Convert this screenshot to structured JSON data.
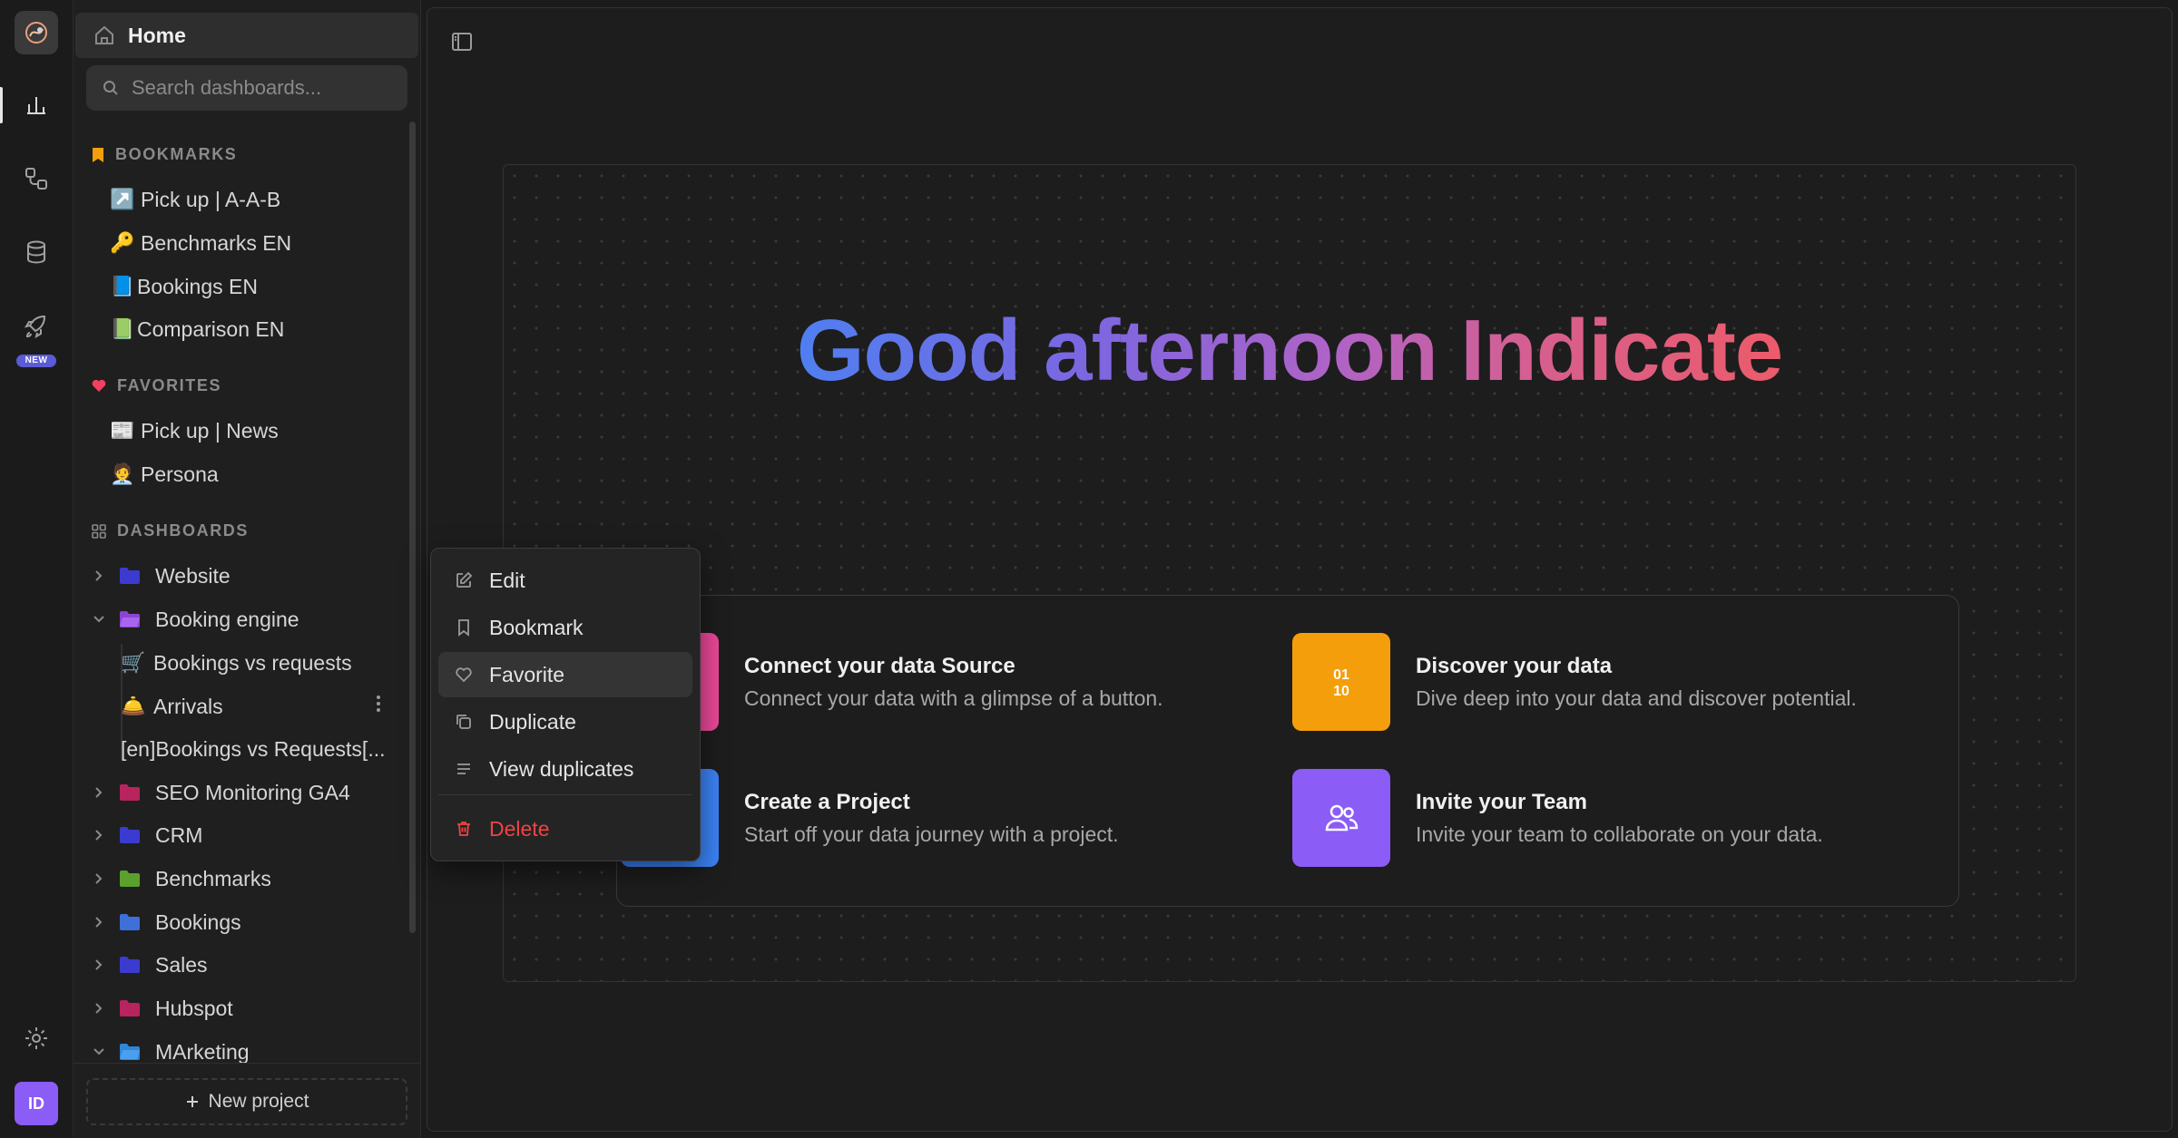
{
  "rail": {
    "new_badge": "NEW",
    "avatar_initials": "ID",
    "icons": [
      "logo-icon",
      "chart-icon",
      "workflow-icon",
      "database-icon",
      "rocket-icon",
      "gear-icon"
    ]
  },
  "sidebar": {
    "home_label": "Home",
    "search_placeholder": "Search dashboards...",
    "bookmarks": {
      "title": "BOOKMARKS",
      "items": [
        {
          "emoji": "↗️",
          "label": "Pick up | A-A-B"
        },
        {
          "emoji": "🔑",
          "label": "Benchmarks EN"
        },
        {
          "emoji": "📘",
          "label": "Bookings EN"
        },
        {
          "emoji": "📗",
          "label": "Comparison EN"
        }
      ]
    },
    "favorites": {
      "title": "FAVORITES",
      "items": [
        {
          "emoji": "📰",
          "label": "Pick up | News"
        },
        {
          "emoji": "🧑‍💼",
          "label": "Persona"
        }
      ]
    },
    "dashboards": {
      "title": "DASHBOARDS",
      "folders": [
        {
          "label": "Website",
          "color": "#3b3bd0",
          "expanded": false
        },
        {
          "label": "Booking engine",
          "color": "#8b45d6",
          "expanded": true
        },
        {
          "label": "SEO Monitoring GA4",
          "color": "#b8245e",
          "expanded": false
        },
        {
          "label": "CRM",
          "color": "#3b3bd0",
          "expanded": false
        },
        {
          "label": "Benchmarks",
          "color": "#5aa02c",
          "expanded": false
        },
        {
          "label": "Bookings",
          "color": "#3f6fd8",
          "expanded": false
        },
        {
          "label": "Sales",
          "color": "#3b3bd0",
          "expanded": false
        },
        {
          "label": "Hubspot",
          "color": "#b8245e",
          "expanded": false
        },
        {
          "label": "MArketing",
          "color": "#2f86d8",
          "expanded": true
        }
      ],
      "children": [
        {
          "emoji": "🛒",
          "label": "Bookings vs requests"
        },
        {
          "emoji": "🛎️",
          "label": "Arrivals"
        },
        {
          "emoji": "",
          "label": "[en]Bookings vs Requests[..."
        }
      ]
    },
    "new_project_label": "New project"
  },
  "main": {
    "greeting": "Good afternoon Indicate",
    "cards": [
      {
        "title": "Connect your data Source",
        "desc": "Connect your data with a glimpse of a button.",
        "color": "#ec4899",
        "icon": "connect-icon"
      },
      {
        "title": "Discover your data",
        "desc": "Dive deep into your data and discover potential.",
        "color": "#f59e0b",
        "icon": "binary-icon",
        "icon_text": "01\n10"
      },
      {
        "title": "Create a Project",
        "desc": "Start off your data journey with a project.",
        "color": "#3b82f6",
        "icon": "project-icon"
      },
      {
        "title": "Invite your Team",
        "desc": "Invite your team to collaborate on your data.",
        "color": "#8b5cf6",
        "icon": "users-icon"
      }
    ]
  },
  "context_menu": {
    "items": [
      {
        "label": "Edit",
        "icon": "edit-icon"
      },
      {
        "label": "Bookmark",
        "icon": "bookmark-icon"
      },
      {
        "label": "Favorite",
        "icon": "heart-icon",
        "highlighted": true
      },
      {
        "label": "Duplicate",
        "icon": "duplicate-icon"
      },
      {
        "label": "View duplicates",
        "icon": "list-icon"
      },
      {
        "label": "Delete",
        "icon": "trash-icon",
        "danger": true
      }
    ]
  },
  "colors": {
    "accent_purple": "#8b5cf6",
    "danger": "#ef4444",
    "bookmark_orange": "#f59e0b",
    "favorite_pink": "#f43f5e"
  }
}
